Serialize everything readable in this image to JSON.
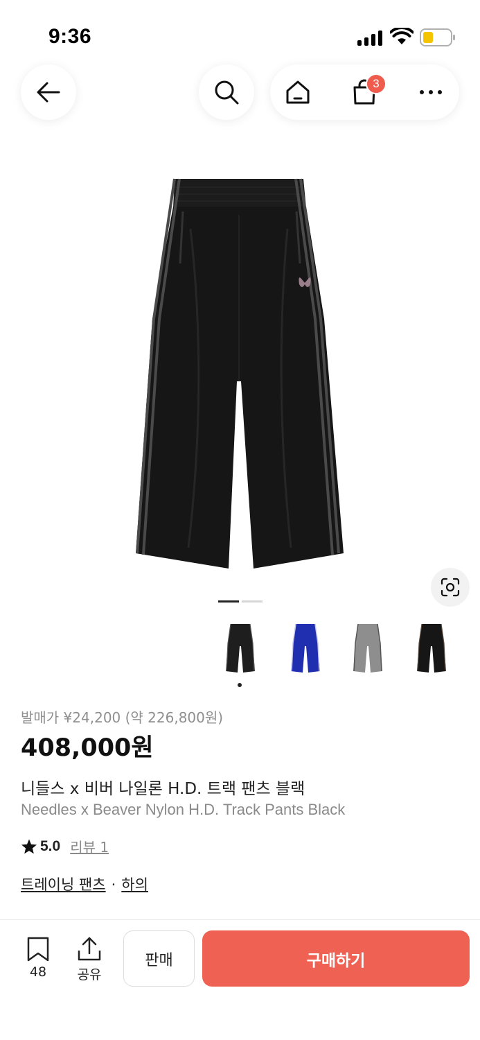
{
  "status_bar": {
    "time": "9:36",
    "signal_icon": "cellular-signal-icon",
    "wifi_icon": "wifi-icon",
    "battery_icon": "battery-low-icon"
  },
  "nav": {
    "back_icon": "arrow-left-icon",
    "search_icon": "search-icon",
    "home_icon": "home-icon",
    "cart_icon": "shopping-bag-icon",
    "cart_badge": "3",
    "more_icon": "more-horizontal-icon"
  },
  "product": {
    "image_icon": "track-pants-image",
    "lens_icon": "visual-search-icon",
    "image_pager": {
      "count": 2,
      "active": 0
    },
    "thumbnails": [
      {
        "name": "black",
        "color": "#1e1e1e"
      },
      {
        "name": "blue",
        "color": "#1f2fb0"
      },
      {
        "name": "grey",
        "color": "#8e8e8e"
      },
      {
        "name": "black-brown",
        "color": "#161616"
      }
    ],
    "selected_thumbnail": 0,
    "release_price": "발매가 ¥24,200 (약 226,800원)",
    "price": "408,000원",
    "name_ko": "니들스 x 비버 나일론  H.D. 트랙 팬츠 블랙",
    "name_en": "Needles x Beaver Nylon H.D. Track Pants Black",
    "rating": "5.0",
    "review_label": "리뷰 1",
    "category_primary": "트레이닝 팬츠",
    "category_separator": "·",
    "category_secondary": "하의"
  },
  "bottom_bar": {
    "bookmark_icon": "bookmark-icon",
    "bookmark_count": "48",
    "share_icon": "share-icon",
    "share_label": "공유",
    "sell_label": "판매",
    "buy_label": "구매하기"
  },
  "colors": {
    "accent": "#ef6253",
    "badge": "#ef5b4d",
    "muted_text": "#8a8a8a"
  }
}
